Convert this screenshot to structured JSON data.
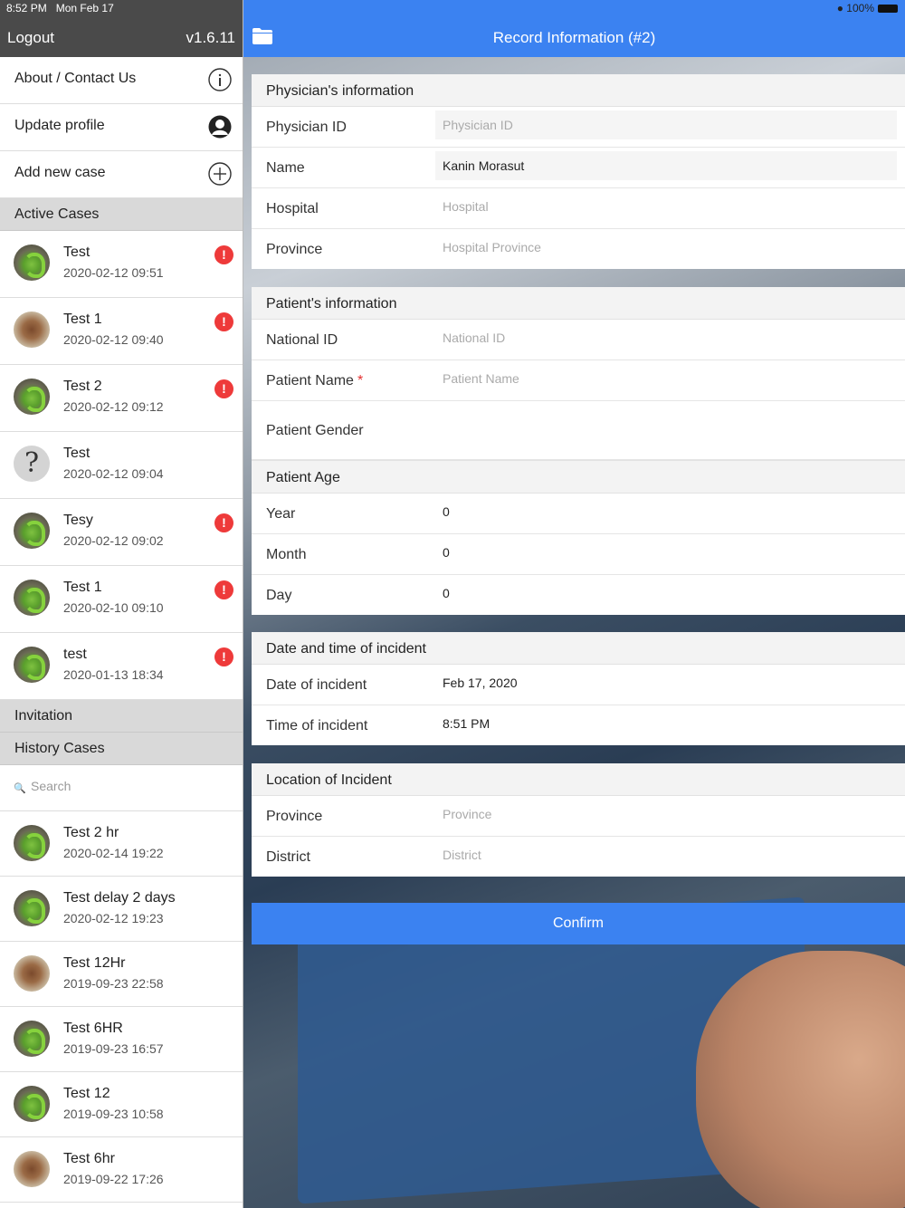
{
  "status": {
    "time": "8:52 PM",
    "day": "Mon Feb 17",
    "battery": "100%"
  },
  "sidebar": {
    "logout": "Logout",
    "version": "v1.6.11",
    "menu": [
      {
        "label": "About / Contact Us",
        "icon": "info-icon"
      },
      {
        "label": "Update profile",
        "icon": "profile-icon"
      },
      {
        "label": "Add new case",
        "icon": "plus-circle-icon"
      }
    ],
    "active_title": "Active Cases",
    "active_cases": [
      {
        "name": "Test",
        "date": "2020-02-12 09:51",
        "alert": "!"
      },
      {
        "name": "Test 1",
        "date": "2020-02-12 09:40",
        "alert": "!"
      },
      {
        "name": "Test 2",
        "date": "2020-02-12 09:12",
        "alert": "!"
      },
      {
        "name": "Test",
        "date": "2020-02-12 09:04",
        "avatar_text": "?"
      },
      {
        "name": "Tesy",
        "date": "2020-02-12 09:02",
        "alert": "!"
      },
      {
        "name": "Test 1",
        "date": "2020-02-10 09:10",
        "alert": "!"
      },
      {
        "name": "test",
        "date": "2020-01-13 18:34",
        "alert": "!"
      }
    ],
    "invitation_title": "Invitation",
    "history_title": "History Cases",
    "search_placeholder": "Search",
    "history_cases": [
      {
        "name": "Test 2 hr",
        "date": "2020-02-14 19:22"
      },
      {
        "name": "Test delay 2 days",
        "date": "2020-02-12 19:23"
      },
      {
        "name": "Test 12Hr",
        "date": "2019-09-23 22:58"
      },
      {
        "name": "Test 6HR",
        "date": "2019-09-23 16:57"
      },
      {
        "name": "Test 12",
        "date": "2019-09-23 10:58"
      },
      {
        "name": "Test 6hr",
        "date": "2019-09-22 17:26"
      }
    ]
  },
  "header": {
    "title": "Record Information (#2)"
  },
  "physician": {
    "title": "Physician's information",
    "id_label": "Physician ID",
    "id_placeholder": "Physician ID",
    "name_label": "Name",
    "name_value": "Kanin Morasut",
    "hospital_label": "Hospital",
    "hospital_placeholder": "Hospital",
    "province_label": "Province",
    "province_placeholder": "Hospital Province"
  },
  "patient": {
    "title": "Patient's information",
    "national_label": "National ID",
    "national_placeholder": "National ID",
    "name_label": "Patient Name",
    "required_mark": "*",
    "name_placeholder": "Patient Name",
    "gender_label": "Patient Gender",
    "age_title": "Patient Age",
    "year_label": "Year",
    "year_value": "0",
    "month_label": "Month",
    "month_value": "0",
    "day_label": "Day",
    "day_value": "0"
  },
  "incident_time": {
    "title": "Date and time of incident",
    "date_label": "Date of incident",
    "date_value": "Feb 17, 2020",
    "time_label": "Time of incident",
    "time_value": "8:51 PM"
  },
  "location": {
    "title": "Location of Incident",
    "province_label": "Province",
    "province_placeholder": "Province",
    "district_label": "District",
    "district_placeholder": "District"
  },
  "confirm_label": "Confirm",
  "colors": {
    "accent": "#3b82f1",
    "alert": "#ee3a3a",
    "sidebar_header": "#4a4a4a"
  }
}
